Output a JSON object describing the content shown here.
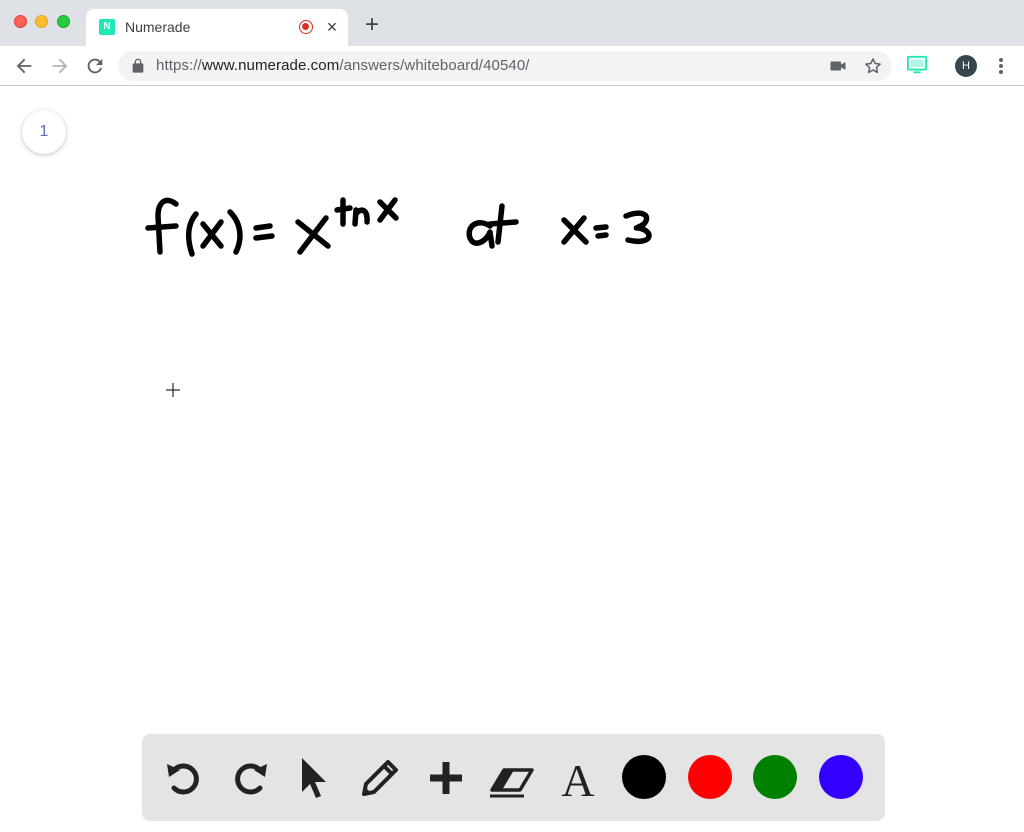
{
  "browser": {
    "tab_title": "Numerade",
    "favicon_letter": "N",
    "url_scheme": "https://",
    "url_host": "www.numerade.com",
    "url_path": "/answers/whiteboard/40540/",
    "avatar_letter": "H"
  },
  "whiteboard": {
    "page_number": "1",
    "handwriting": "f(x) = x^(ln x)   at   x = 3"
  },
  "palette": {
    "tools": [
      "undo-icon",
      "redo-icon",
      "select-pointer-icon",
      "pencil-icon",
      "add-plus-icon",
      "eraser-icon",
      "text-tool-icon"
    ],
    "colors": [
      "#000000",
      "#ff0000",
      "#008000",
      "#3300ff"
    ]
  }
}
